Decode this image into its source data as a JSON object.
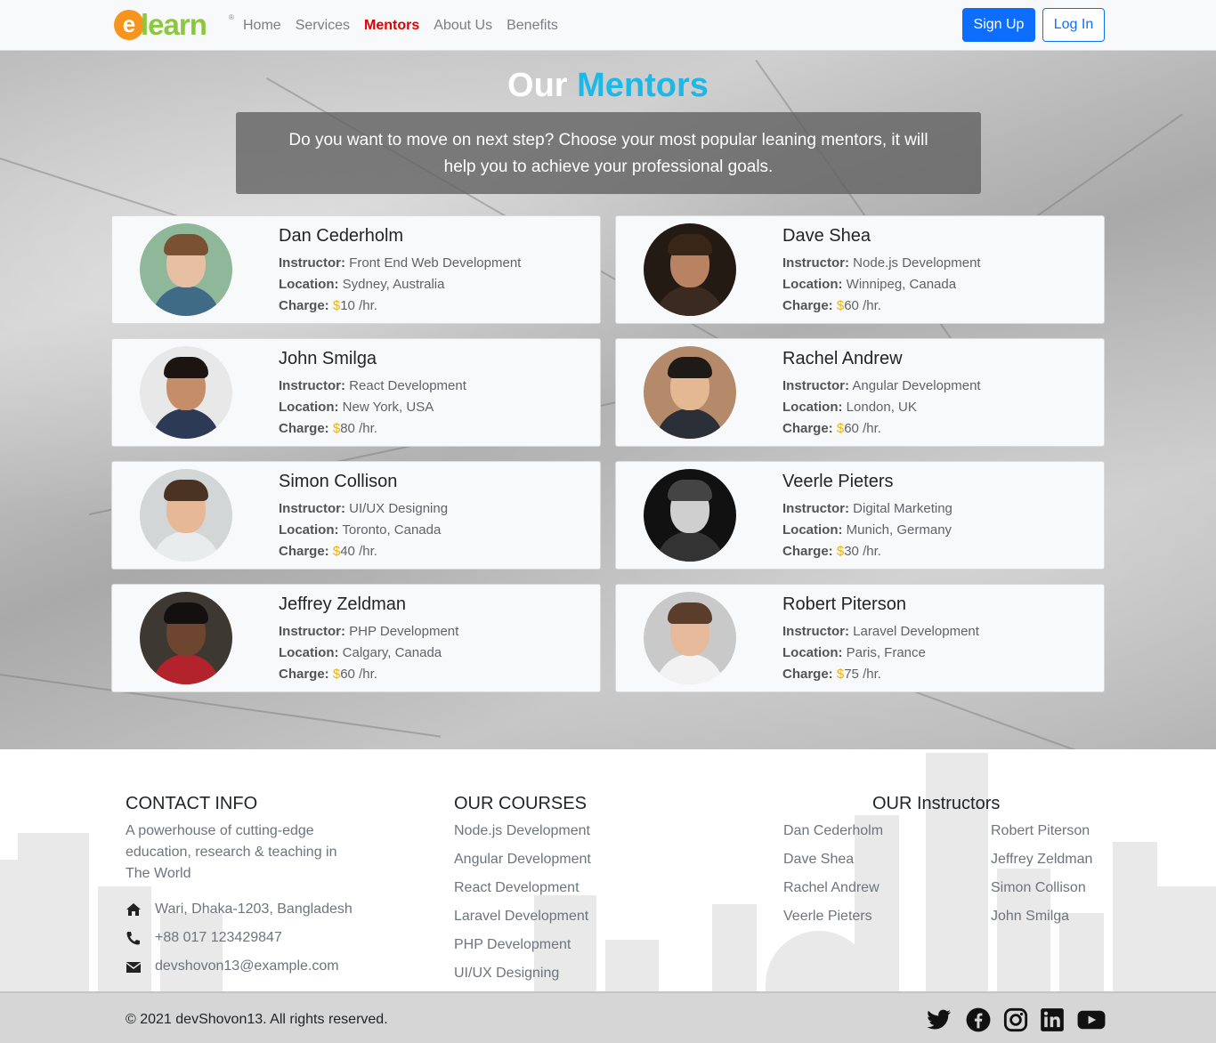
{
  "nav": {
    "logo": {
      "e": "e",
      "text": "learn"
    },
    "links": [
      "Home",
      "Services",
      "Mentors",
      "About Us",
      "Benefits"
    ],
    "active": "Mentors",
    "signup": "Sign Up",
    "login": "Log In"
  },
  "hero": {
    "title_part1": "Our",
    "title_part2": "Mentors",
    "intro": "Do you want to move on next step? Choose your most popular leaning mentors, it will help you to achieve your professional goals."
  },
  "labels": {
    "instructor": "Instructor:",
    "location": "Location:",
    "charge": "Charge:",
    "currency": "$",
    "per_hr": "/hr."
  },
  "mentors": [
    {
      "name": "Dan Cederholm",
      "instructor": "Front End Web Development",
      "location": "Sydney, Australia",
      "charge": "10"
    },
    {
      "name": "Dave Shea",
      "instructor": "Node.js Development",
      "location": "Winnipeg, Canada",
      "charge": "60"
    },
    {
      "name": "John Smilga",
      "instructor": "React Development",
      "location": "New York, USA",
      "charge": "80"
    },
    {
      "name": "Rachel Andrew",
      "instructor": "Angular Development",
      "location": "London, UK",
      "charge": "60"
    },
    {
      "name": "Simon Collison",
      "instructor": "UI/UX Designing",
      "location": "Toronto, Canada",
      "charge": "40"
    },
    {
      "name": "Veerle Pieters",
      "instructor": "Digital Marketing",
      "location": "Munich, Germany",
      "charge": "30"
    },
    {
      "name": "Jeffrey Zeldman",
      "instructor": "PHP Development",
      "location": "Calgary, Canada",
      "charge": "60"
    },
    {
      "name": "Robert Piterson",
      "instructor": "Laravel Development",
      "location": "Paris, France",
      "charge": "75"
    }
  ],
  "footer": {
    "contact_heading": "CONTACT INFO",
    "contact_lines": [
      "A powerhouse of cutting-edge",
      "education, research & teaching in",
      "The World"
    ],
    "address": "Wari, Dhaka-1203, Bangladesh",
    "phone": "+88 017 123429847",
    "email": "devshovon13@example.com",
    "courses_heading": "OUR COURSES",
    "courses": [
      "Node.js Development",
      "Angular Development",
      "React Development",
      "Laravel Development",
      "PHP Development",
      "UI/UX Designing"
    ],
    "instructors_heading": "OUR Instructors",
    "instructors_col1": [
      "Dan Cederholm",
      "Dave Shea",
      "Rachel Andrew",
      "Veerle Pieters"
    ],
    "instructors_col2": [
      "Robert Piterson",
      "Jeffrey Zeldman",
      "Simon Collison",
      "John Smilga"
    ],
    "copyright": "© 2021 devShovon13. All rights reserved.",
    "social": [
      "twitter-icon",
      "facebook-icon",
      "instagram-icon",
      "linkedin-icon",
      "youtube-icon"
    ]
  },
  "colors": {
    "accent": "#1bb8e8",
    "primary": "#0d6efd",
    "active_nav": "#e00000",
    "charge": "#f0b400"
  }
}
